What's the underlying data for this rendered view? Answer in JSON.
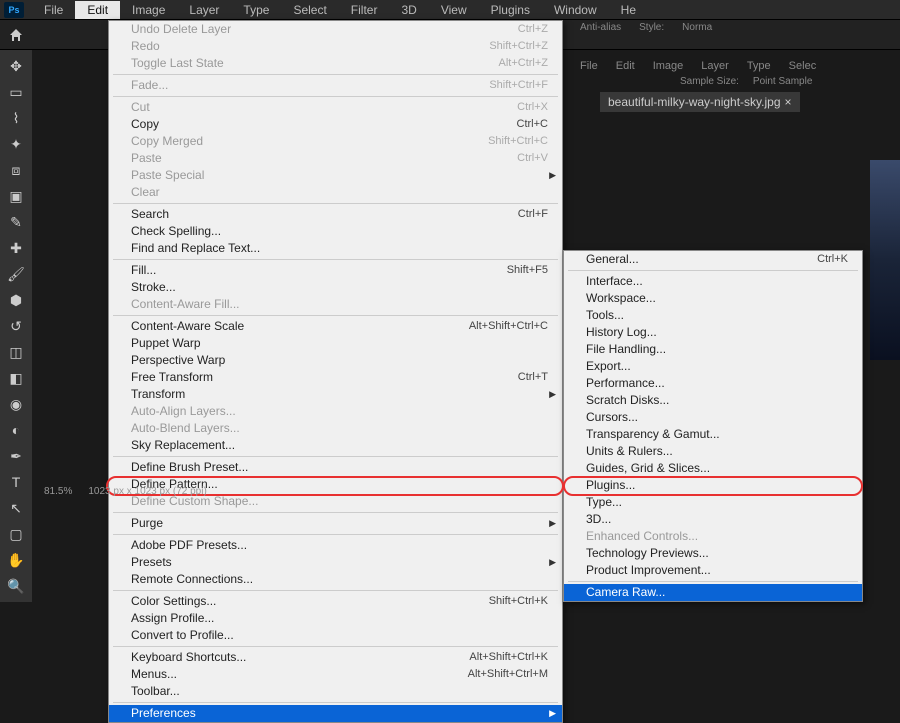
{
  "app": {
    "logo": "Ps"
  },
  "menubar": [
    "File",
    "Edit",
    "Image",
    "Layer",
    "Type",
    "Select",
    "Filter",
    "3D",
    "View",
    "Plugins",
    "Window",
    "He"
  ],
  "menubar_open_index": 1,
  "options_bar": {
    "anti_alias": "Anti-alias",
    "style": "Style:",
    "style_value": "Norma"
  },
  "settings_strip": {
    "sample_size": "Sample Size:",
    "point_sample": "Point Sample"
  },
  "second_menu": [
    "File",
    "Edit",
    "Image",
    "Layer",
    "Type",
    "Selec"
  ],
  "document_tab": {
    "name": "beautiful-milky-way-night-sky.jpg",
    "close": "×"
  },
  "status": {
    "zoom": "81.5%",
    "dims": "1023 px x 1023 px (72 ppi)"
  },
  "edit_menu": [
    {
      "label": "Undo Delete Layer",
      "shortcut": "Ctrl+Z",
      "disabled": true
    },
    {
      "label": "Redo",
      "shortcut": "Shift+Ctrl+Z",
      "disabled": true
    },
    {
      "label": "Toggle Last State",
      "shortcut": "Alt+Ctrl+Z",
      "disabled": true
    },
    {
      "sep": true
    },
    {
      "label": "Fade...",
      "shortcut": "Shift+Ctrl+F",
      "disabled": true
    },
    {
      "sep": true
    },
    {
      "label": "Cut",
      "shortcut": "Ctrl+X",
      "disabled": true
    },
    {
      "label": "Copy",
      "shortcut": "Ctrl+C"
    },
    {
      "label": "Copy Merged",
      "shortcut": "Shift+Ctrl+C",
      "disabled": true
    },
    {
      "label": "Paste",
      "shortcut": "Ctrl+V",
      "disabled": true
    },
    {
      "label": "Paste Special",
      "submenu": true,
      "disabled": true
    },
    {
      "label": "Clear",
      "disabled": true
    },
    {
      "sep": true
    },
    {
      "label": "Search",
      "shortcut": "Ctrl+F"
    },
    {
      "label": "Check Spelling..."
    },
    {
      "label": "Find and Replace Text..."
    },
    {
      "sep": true
    },
    {
      "label": "Fill...",
      "shortcut": "Shift+F5"
    },
    {
      "label": "Stroke..."
    },
    {
      "label": "Content-Aware Fill...",
      "disabled": true
    },
    {
      "sep": true
    },
    {
      "label": "Content-Aware Scale",
      "shortcut": "Alt+Shift+Ctrl+C"
    },
    {
      "label": "Puppet Warp"
    },
    {
      "label": "Perspective Warp"
    },
    {
      "label": "Free Transform",
      "shortcut": "Ctrl+T"
    },
    {
      "label": "Transform",
      "submenu": true
    },
    {
      "label": "Auto-Align Layers...",
      "disabled": true
    },
    {
      "label": "Auto-Blend Layers...",
      "disabled": true
    },
    {
      "label": "Sky Replacement..."
    },
    {
      "sep": true
    },
    {
      "label": "Define Brush Preset..."
    },
    {
      "label": "Define Pattern..."
    },
    {
      "label": "Define Custom Shape...",
      "disabled": true
    },
    {
      "sep": true
    },
    {
      "label": "Purge",
      "submenu": true
    },
    {
      "sep": true
    },
    {
      "label": "Adobe PDF Presets..."
    },
    {
      "label": "Presets",
      "submenu": true
    },
    {
      "label": "Remote Connections..."
    },
    {
      "sep": true
    },
    {
      "label": "Color Settings...",
      "shortcut": "Shift+Ctrl+K"
    },
    {
      "label": "Assign Profile..."
    },
    {
      "label": "Convert to Profile..."
    },
    {
      "sep": true
    },
    {
      "label": "Keyboard Shortcuts...",
      "shortcut": "Alt+Shift+Ctrl+K"
    },
    {
      "label": "Menus...",
      "shortcut": "Alt+Shift+Ctrl+M"
    },
    {
      "label": "Toolbar..."
    },
    {
      "sep": true
    },
    {
      "label": "Preferences",
      "submenu": true,
      "highlight": true
    }
  ],
  "prefs_menu": [
    {
      "label": "General...",
      "shortcut": "Ctrl+K"
    },
    {
      "sep": true
    },
    {
      "label": "Interface..."
    },
    {
      "label": "Workspace..."
    },
    {
      "label": "Tools..."
    },
    {
      "label": "History Log..."
    },
    {
      "label": "File Handling..."
    },
    {
      "label": "Export..."
    },
    {
      "label": "Performance..."
    },
    {
      "label": "Scratch Disks..."
    },
    {
      "label": "Cursors..."
    },
    {
      "label": "Transparency & Gamut..."
    },
    {
      "label": "Units & Rulers..."
    },
    {
      "label": "Guides, Grid & Slices..."
    },
    {
      "label": "Plugins..."
    },
    {
      "label": "Type..."
    },
    {
      "label": "3D..."
    },
    {
      "label": "Enhanced Controls...",
      "disabled": true
    },
    {
      "label": "Technology Previews..."
    },
    {
      "label": "Product Improvement..."
    },
    {
      "sep": true
    },
    {
      "label": "Camera Raw...",
      "highlight": true
    }
  ],
  "tools": [
    "move",
    "marquee",
    "lasso",
    "wand",
    "crop",
    "frame",
    "eyedropper",
    "heal",
    "brush",
    "stamp",
    "history",
    "eraser",
    "gradient",
    "blur",
    "dodge",
    "pen",
    "type",
    "path",
    "rect",
    "hand",
    "zoom"
  ]
}
